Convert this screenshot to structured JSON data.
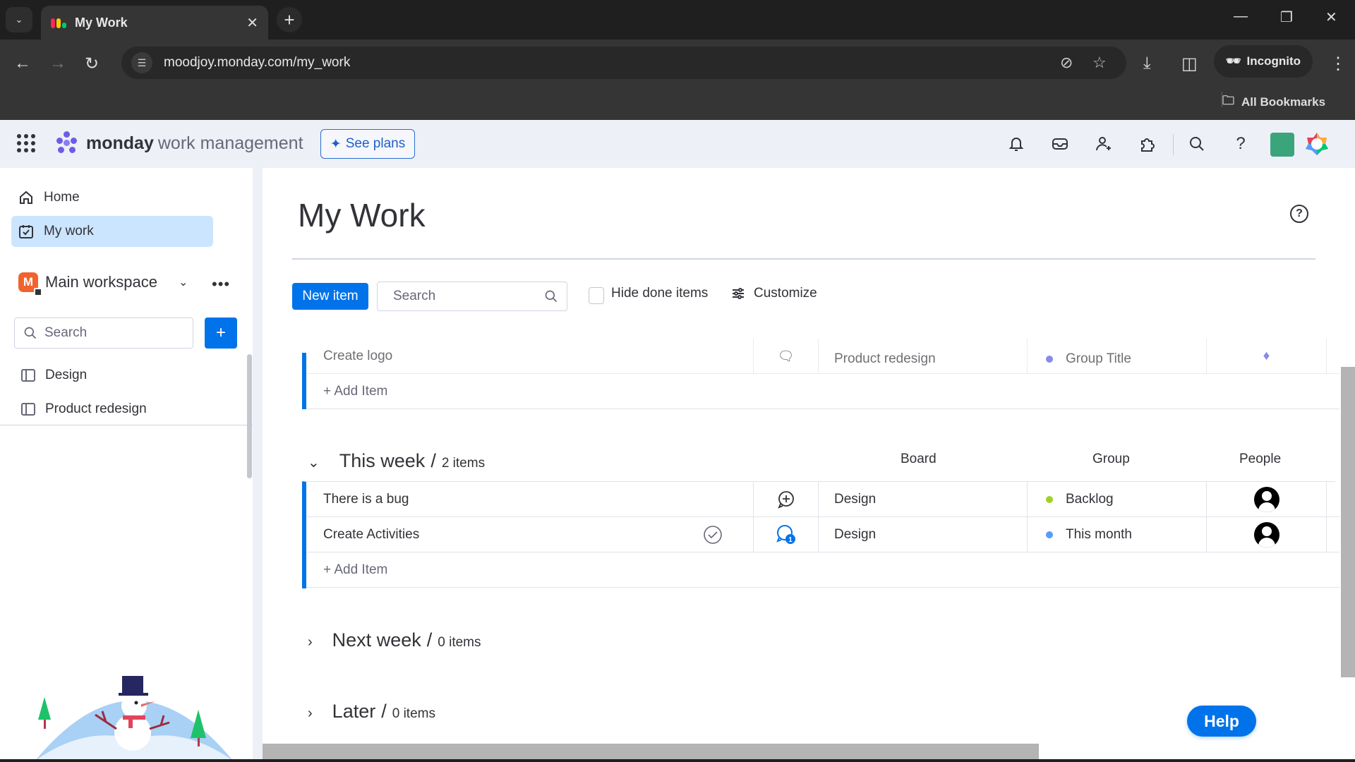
{
  "browser": {
    "tab_title": "My Work",
    "url": "moodjoy.monday.com/my_work",
    "incognito_label": "Incognito",
    "bookmarks_label": "All Bookmarks"
  },
  "header": {
    "brand_bold": "monday",
    "brand_light": "work management",
    "see_plans": "See plans",
    "icons": [
      "bell-icon",
      "inbox-icon",
      "invite-user-icon",
      "apps-puzzle-icon",
      "search-icon",
      "help-icon"
    ]
  },
  "sidebar": {
    "nav": [
      {
        "label": "Home",
        "icon": "home-icon",
        "active": false
      },
      {
        "label": "My work",
        "icon": "calendar-check-icon",
        "active": true
      }
    ],
    "workspace": {
      "badge": "M",
      "name": "Main workspace"
    },
    "search_placeholder": "Search",
    "boards": [
      {
        "label": "Design"
      },
      {
        "label": "Product redesign"
      }
    ]
  },
  "main": {
    "title": "My Work",
    "new_item": "New item",
    "search_placeholder": "Search",
    "hide_done": "Hide done items",
    "customize": "Customize",
    "columns": {
      "board": "Board",
      "group": "Group",
      "people": "People"
    },
    "add_item": "+ Add Item",
    "partial_row": {
      "name": "Create logo",
      "board": "Product redesign",
      "group": "Group Title",
      "group_color": "#5559df"
    },
    "groups": [
      {
        "title": "This week",
        "count": "2 items",
        "expanded": true,
        "rows": [
          {
            "name": "There is a bug",
            "board": "Design",
            "group": "Backlog",
            "group_color": "#9cd326",
            "has_updates": false,
            "update_count": ""
          },
          {
            "name": "Create Activities",
            "board": "Design",
            "group": "This month",
            "group_color": "#579bfc",
            "has_updates": true,
            "update_count": "1"
          }
        ]
      },
      {
        "title": "Next week",
        "count": "0 items",
        "expanded": false
      },
      {
        "title": "Later",
        "count": "0 items",
        "expanded": false
      }
    ],
    "help_button": "Help"
  },
  "colors": {
    "primary": "#0073ea",
    "header_bg": "#eef0f7",
    "active_nav": "#cce5ff"
  }
}
